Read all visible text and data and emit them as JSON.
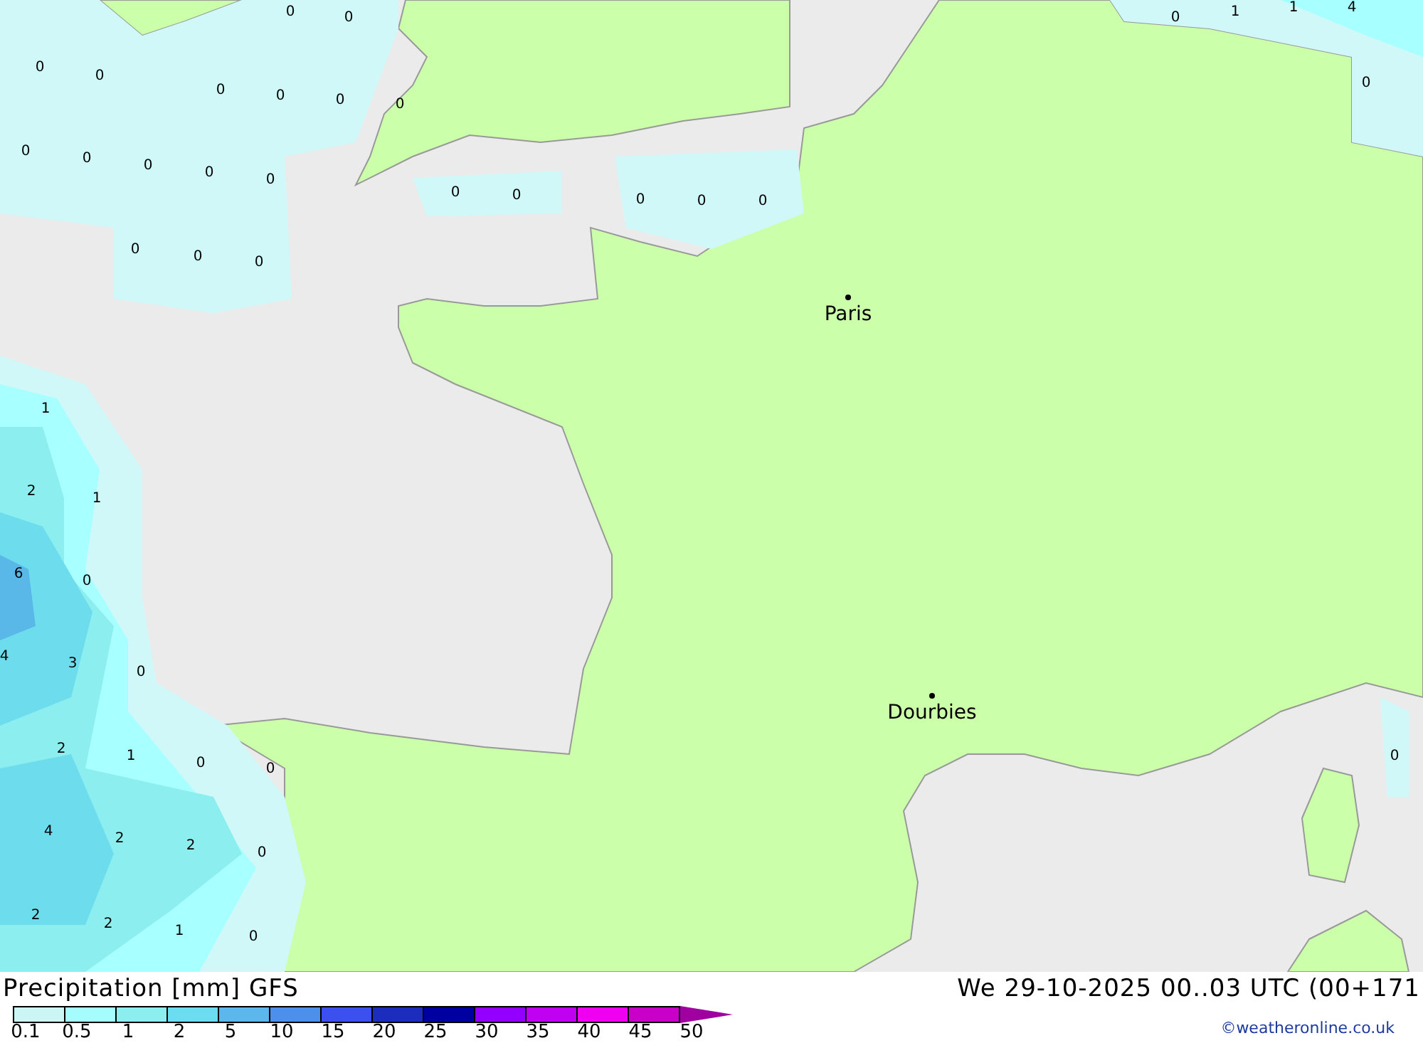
{
  "map": {
    "values": [
      "0",
      "0",
      "0",
      "0",
      "0",
      "0",
      "0",
      "0",
      "0",
      "0",
      "0",
      "0",
      "0",
      "0",
      "0",
      "0",
      "0",
      "0",
      "0",
      "0",
      "0",
      "0",
      "1",
      "1",
      "4",
      "0",
      "1",
      "2",
      "1",
      "6",
      "0",
      "4",
      "3",
      "0",
      "2",
      "1",
      "0",
      "0",
      "4",
      "2",
      "2",
      "0",
      "2",
      "2",
      "1",
      "0",
      "0"
    ],
    "cities": [
      {
        "name": "Paris"
      },
      {
        "name": "Dourbies"
      }
    ]
  },
  "footer": {
    "title": "Precipitation [mm] GFS",
    "valid_time": "We 29-10-2025 00..03 UTC (00+171",
    "credit": "©weatheronline.co.uk"
  },
  "legend": {
    "segments": [
      {
        "color": "#ccf6f6"
      },
      {
        "color": "#a4fcfc"
      },
      {
        "color": "#8ceeee"
      },
      {
        "color": "#6cdcf0"
      },
      {
        "color": "#5cb8ec"
      },
      {
        "color": "#4c90ec"
      },
      {
        "color": "#3c50f0"
      },
      {
        "color": "#1c2cbc"
      },
      {
        "color": "#0000a0"
      },
      {
        "color": "#9400ff"
      },
      {
        "color": "#c000f0"
      },
      {
        "color": "#f000f0"
      },
      {
        "color": "#c800c8"
      }
    ],
    "ticks": [
      "0.1",
      "0.5",
      "1",
      "2",
      "5",
      "10",
      "15",
      "20",
      "25",
      "30",
      "35",
      "40",
      "45",
      "50"
    ]
  }
}
